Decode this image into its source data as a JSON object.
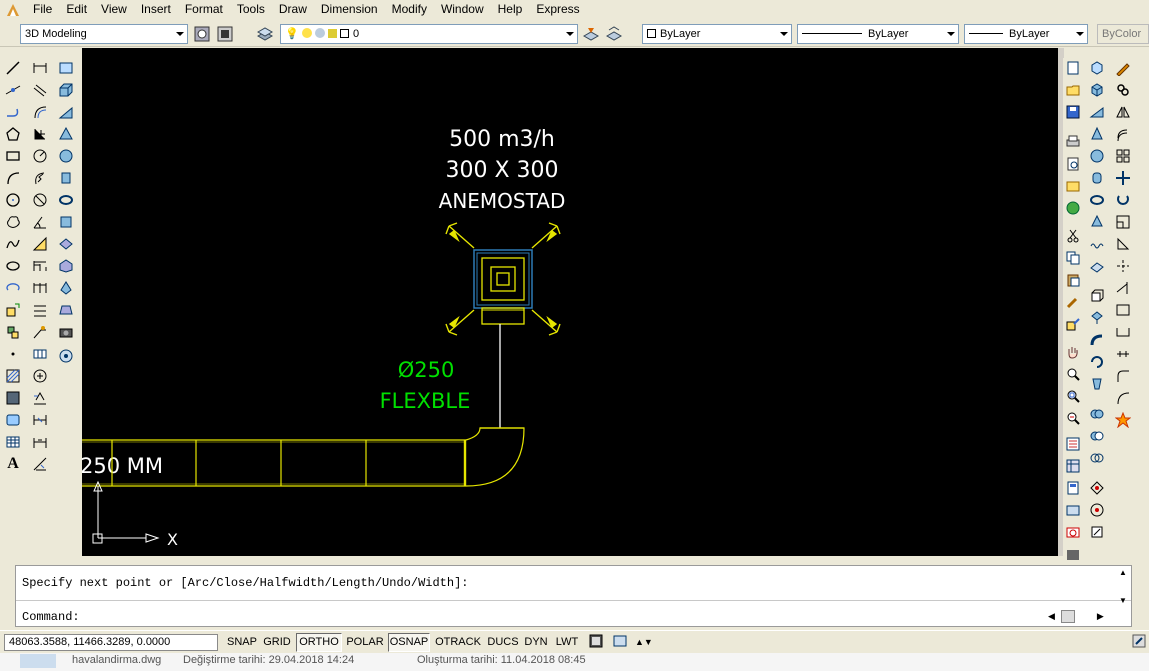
{
  "menu": [
    "File",
    "Edit",
    "View",
    "Insert",
    "Format",
    "Tools",
    "Draw",
    "Dimension",
    "Modify",
    "Window",
    "Help",
    "Express"
  ],
  "toolbar": {
    "workspace": "3D Modeling",
    "layer": "0",
    "color": "ByLayer",
    "linetype": "ByLayer",
    "lineweight": "ByLayer",
    "plotstyle": "ByColor"
  },
  "drawing": {
    "flow": "500 m3/h",
    "size": "300 X 300",
    "device": "ANEMOSTAD",
    "flex_dia": "Ø250",
    "flex_label": "FLEXBLE",
    "duct_label": "250 MM",
    "ucs_x": "X"
  },
  "command": {
    "line1": "Specify next point or [Arc/Close/Halfwidth/Length/Undo/Width]:",
    "line2": "Command:"
  },
  "status": {
    "coords": "48063.3588, 11466.3289, 0.0000",
    "toggles": [
      "SNAP",
      "GRID",
      "ORTHO",
      "POLAR",
      "OSNAP",
      "OTRACK",
      "DUCS",
      "DYN",
      "LWT"
    ]
  },
  "taskbar": {
    "file": "havalandirma.dwg",
    "modified": "Değiştirme tarihi: 29.04.2018 14:24",
    "created": "Oluşturma tarihi: 11.04.2018 08:45"
  },
  "colors": {
    "duct": "#e6e600",
    "text": "#ffffff",
    "flex": "#00e000",
    "viewport": "#000000"
  }
}
